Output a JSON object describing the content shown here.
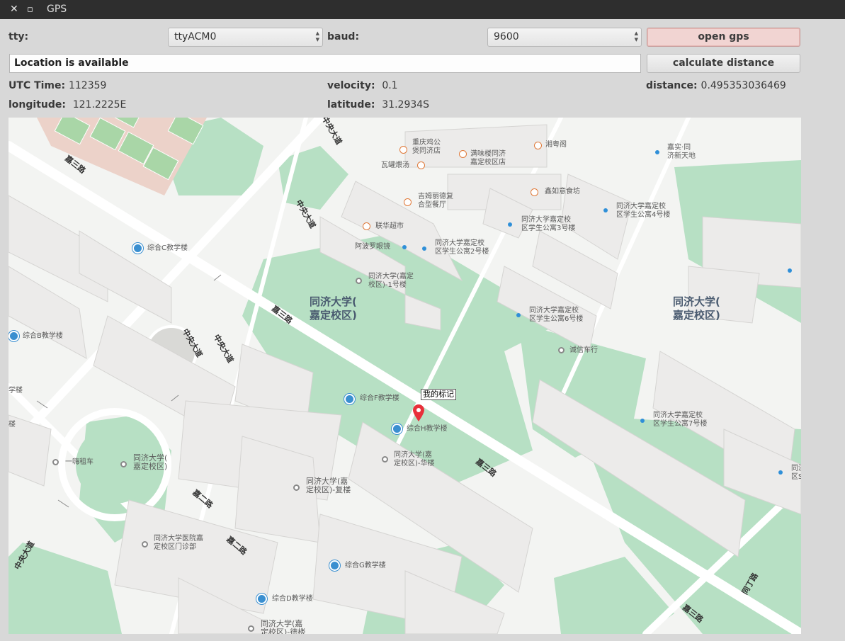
{
  "window": {
    "title": "GPS",
    "close_glyph": "✕",
    "maximize_glyph": "▫"
  },
  "controls": {
    "tty_label": "tty:",
    "tty_value": "ttyACM0",
    "baud_label": "baud:",
    "baud_value": "9600",
    "open_gps_label": "open gps",
    "status_text": "Location is available",
    "calc_distance_label": "calculate distance"
  },
  "readouts": {
    "utc_label": "UTC Time:",
    "utc_value": "112359",
    "velocity_label": "velocity:",
    "velocity_value": "0.1",
    "distance_label": "distance:",
    "distance_value": "0.495353036469",
    "longitude_label": "longitude:",
    "longitude_value": "121.2225E",
    "latitude_label": "latitude:",
    "latitude_value": "31.2934S"
  },
  "map": {
    "marker_label": "我的标记",
    "campus_labels": [
      "同济大学(\n嘉定校区)",
      "同济大学(\n嘉定校区)"
    ],
    "roads": [
      "嘉三路",
      "嘉三路",
      "嘉三路",
      "嘉三路",
      "中央大道",
      "中央大道",
      "中央大道",
      "中央大道",
      "中央大道",
      "嘉二路",
      "嘉二路",
      "同丁路"
    ],
    "pois": [
      "重庆鸡公\n煲同济店",
      "满味楼同济\n嘉定校区店",
      "湘粤阁",
      "嘉实·同\n济新天地",
      "瓦罐煨汤",
      "吉姆丽德复\n合型餐厅",
      "鑫如意食坊",
      "同济大学嘉定校\n区学生公寓4号楼",
      "联华超市",
      "同济大学嘉定校\n区学生公寓3号楼",
      "阿波罗眼镜",
      "同济大学嘉定校\n区学生公寓2号楼",
      "综合C教学楼",
      "同济大学(嘉定\n校区)-1号楼",
      "同济大学嘉定校\n区学生公寓6号楼",
      "综合B教学楼",
      "诚信车行",
      "学楼",
      "综合F教学楼",
      "综合H教学楼",
      "同济大学嘉定校\n区学生公寓7号楼",
      "同济大学(嘉\n定校区)-华楼",
      "一嗨租车",
      "同济大学(\n嘉定校区)",
      "同济大学(嘉\n定校区)-复楼",
      "同济大学医院嘉\n定校区门诊部",
      "综合G教学楼",
      "综合D教学楼",
      "同济大学(嘉\n定校区)-德楼",
      "同济\n区S",
      "楼"
    ]
  }
}
